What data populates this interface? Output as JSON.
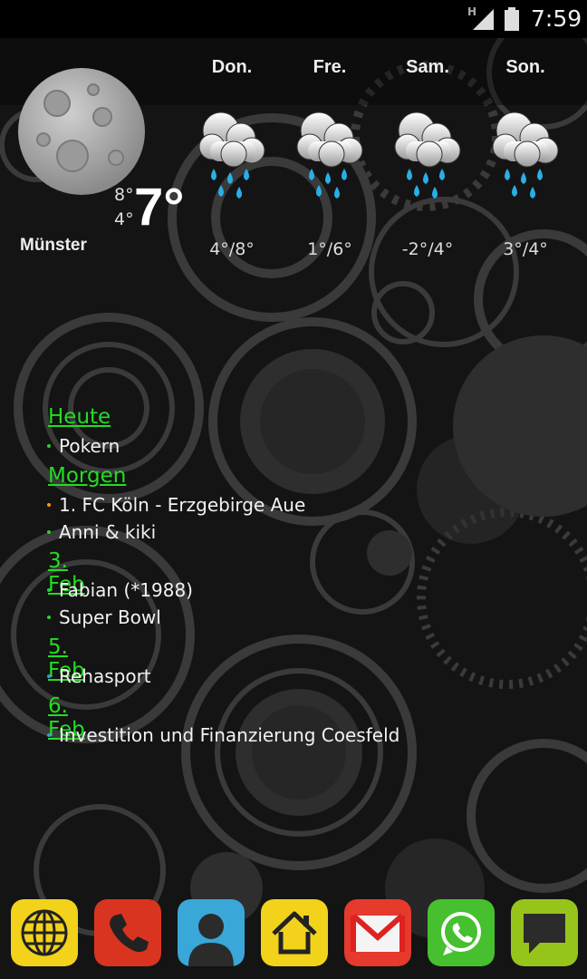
{
  "status": {
    "network": "H",
    "time": "7:59"
  },
  "weather": {
    "city": "Münster",
    "current_temp": "7°",
    "high": "8°",
    "low": "4°",
    "forecast": [
      {
        "day": "Don.",
        "temps": "4°/8°",
        "icon": "rain-cloud-icon"
      },
      {
        "day": "Fre.",
        "temps": "1°/6°",
        "icon": "rain-cloud-icon"
      },
      {
        "day": "Sam.",
        "temps": "-2°/4°",
        "icon": "rain-cloud-icon"
      },
      {
        "day": "Son.",
        "temps": "3°/4°",
        "icon": "rain-cloud-icon"
      }
    ]
  },
  "agenda": {
    "colors": {
      "heading": "#22dd22",
      "green": "#33cc33",
      "orange": "#ff9900",
      "blue": "#3399dd"
    },
    "groups": [
      {
        "heading": "Heute",
        "items": [
          {
            "text": "Pokern",
            "color": "green"
          }
        ]
      },
      {
        "heading": "Morgen",
        "items": [
          {
            "text": "1. FC Köln - Erzgebirge Aue",
            "color": "orange"
          },
          {
            "text": "Anni & kiki",
            "color": "green"
          }
        ]
      },
      {
        "heading": "3. Feb",
        "items": [
          {
            "text": "Fabian (*1988)",
            "color": "green"
          },
          {
            "text": "Super Bowl",
            "color": "green"
          }
        ]
      },
      {
        "heading": "5. Feb",
        "items": [
          {
            "text": "Rehasport",
            "color": "blue"
          }
        ]
      },
      {
        "heading": "6. Feb",
        "items": [
          {
            "text": "Investition und Finanzierung Coesfeld",
            "color": "blue"
          }
        ]
      }
    ]
  },
  "dock": [
    {
      "icon": "globe-icon",
      "color": "#f2d21b"
    },
    {
      "icon": "phone-icon",
      "color": "#d9341f"
    },
    {
      "icon": "contacts-icon",
      "color": "#39a7d8"
    },
    {
      "icon": "home-icon",
      "color": "#f2d21b"
    },
    {
      "icon": "gmail-icon",
      "color": "#e53a2c"
    },
    {
      "icon": "whatsapp-icon",
      "color": "#46c02e"
    },
    {
      "icon": "messaging-icon",
      "color": "#97c41b"
    }
  ]
}
